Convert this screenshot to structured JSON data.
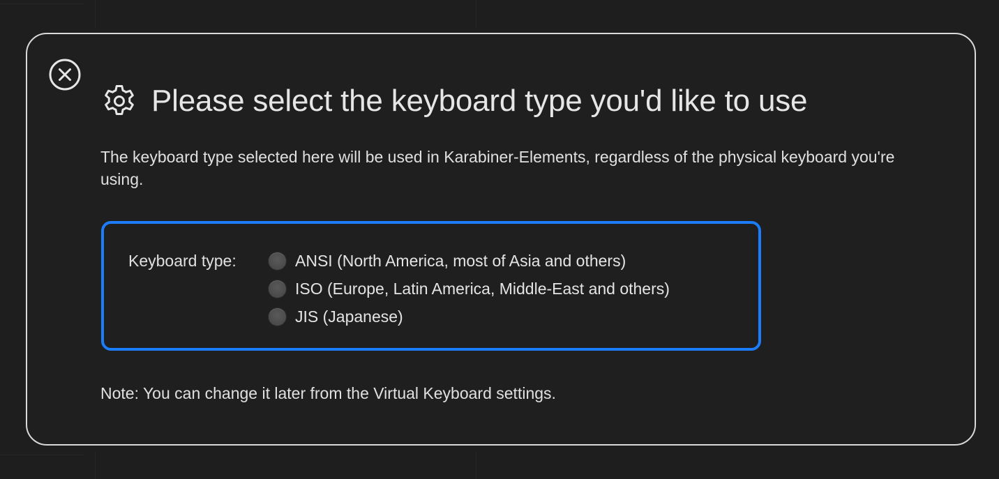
{
  "dialog": {
    "title": "Please select the keyboard type you'd like to use",
    "description": "The keyboard type selected here will be used in Karabiner-Elements, regardless of the physical keyboard you're using.",
    "close_icon": "close-circle-icon",
    "title_icon": "gear-icon",
    "accent_color": "#1c7dfa"
  },
  "keyboard_type": {
    "label": "Keyboard type:",
    "options": [
      {
        "label": "ANSI (North America, most of Asia and others)",
        "selected": false
      },
      {
        "label": "ISO (Europe, Latin America, Middle-East and others)",
        "selected": false
      },
      {
        "label": "JIS (Japanese)",
        "selected": false
      }
    ]
  },
  "note": "Note: You can change it later from the Virtual Keyboard settings."
}
